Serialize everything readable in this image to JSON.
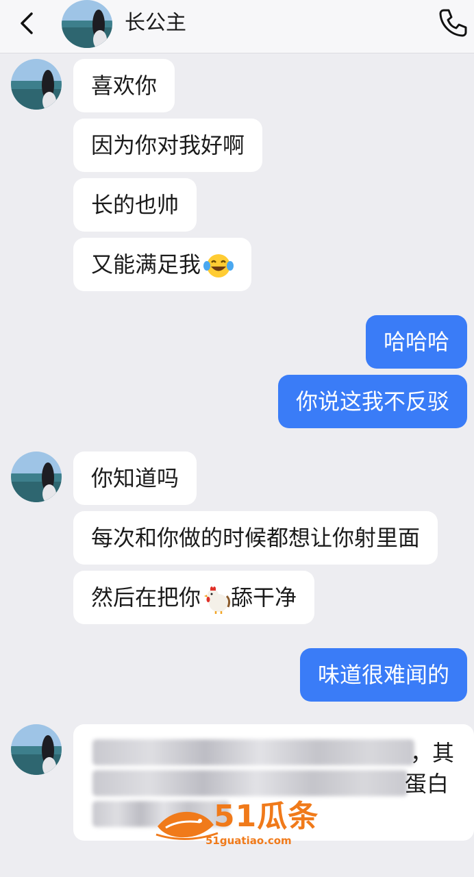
{
  "header": {
    "title": "长公主",
    "back_icon": "chevron-left-icon",
    "call_icon": "phone-icon"
  },
  "messages": [
    {
      "side": "left",
      "text": "喜欢你"
    },
    {
      "side": "left",
      "text": "因为你对我好啊"
    },
    {
      "side": "left",
      "text": "长的也帅"
    },
    {
      "side": "left",
      "text": "又能满足我",
      "emoji": "tears-of-joy-emoji"
    },
    {
      "side": "right",
      "text": "哈哈哈"
    },
    {
      "side": "right",
      "text": "你说这我不反驳"
    },
    {
      "side": "left",
      "text": "你知道吗"
    },
    {
      "side": "left",
      "text": "每次和你做的时候都想让你射里面"
    },
    {
      "side": "left",
      "text": "然后在把你",
      "emoji": "rooster-emoji",
      "text_after": "舔干净"
    },
    {
      "side": "right",
      "text": "味道很难闻的"
    }
  ],
  "blurred_message": {
    "visible_fragments": [
      "，其",
      "蛋白"
    ]
  },
  "watermark": {
    "brand": "51瓜条",
    "url": "51guatiao.com"
  },
  "colors": {
    "background": "#ededf1",
    "outgoing_bubble": "#3a7cf7",
    "incoming_bubble": "#ffffff",
    "watermark": "#f07a1a"
  }
}
